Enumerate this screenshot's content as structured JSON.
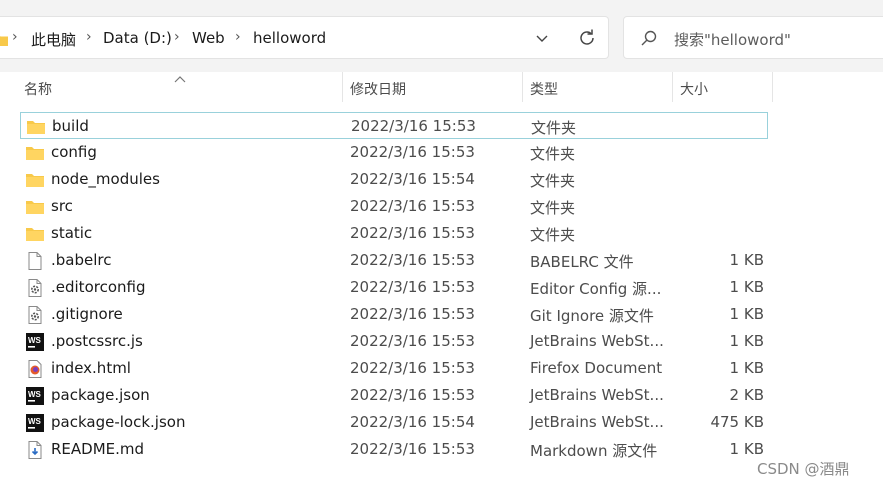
{
  "breadcrumb": [
    "此电脑",
    "Data (D:)",
    "Web",
    "helloword"
  ],
  "search": {
    "placeholder": "搜索\"helloword\""
  },
  "columns": {
    "name": "名称",
    "modified": "修改日期",
    "type": "类型",
    "size": "大小"
  },
  "files": [
    {
      "name": "build",
      "modified": "2022/3/16 15:53",
      "type": "文件夹",
      "size": "",
      "icon": "folder-icon",
      "selected": true
    },
    {
      "name": "config",
      "modified": "2022/3/16 15:53",
      "type": "文件夹",
      "size": "",
      "icon": "folder-icon"
    },
    {
      "name": "node_modules",
      "modified": "2022/3/16 15:54",
      "type": "文件夹",
      "size": "",
      "icon": "folder-icon"
    },
    {
      "name": "src",
      "modified": "2022/3/16 15:53",
      "type": "文件夹",
      "size": "",
      "icon": "folder-icon"
    },
    {
      "name": "static",
      "modified": "2022/3/16 15:53",
      "type": "文件夹",
      "size": "",
      "icon": "folder-icon"
    },
    {
      "name": ".babelrc",
      "modified": "2022/3/16 15:53",
      "type": "BABELRC 文件",
      "size": "1 KB",
      "icon": "file-icon"
    },
    {
      "name": ".editorconfig",
      "modified": "2022/3/16 15:53",
      "type": "Editor Config 源...",
      "size": "1 KB",
      "icon": "config-file-icon"
    },
    {
      "name": ".gitignore",
      "modified": "2022/3/16 15:53",
      "type": "Git Ignore 源文件",
      "size": "1 KB",
      "icon": "config-file-icon"
    },
    {
      "name": ".postcssrc.js",
      "modified": "2022/3/16 15:53",
      "type": "JetBrains WebSt...",
      "size": "1 KB",
      "icon": "webstorm-icon"
    },
    {
      "name": "index.html",
      "modified": "2022/3/16 15:53",
      "type": "Firefox Document",
      "size": "1 KB",
      "icon": "firefox-document-icon"
    },
    {
      "name": "package.json",
      "modified": "2022/3/16 15:53",
      "type": "JetBrains WebSt...",
      "size": "2 KB",
      "icon": "webstorm-icon"
    },
    {
      "name": "package-lock.json",
      "modified": "2022/3/16 15:54",
      "type": "JetBrains WebSt...",
      "size": "475 KB",
      "icon": "webstorm-icon"
    },
    {
      "name": "README.md",
      "modified": "2022/3/16 15:53",
      "type": "Markdown 源文件",
      "size": "1 KB",
      "icon": "markdown-file-icon"
    }
  ],
  "watermark": "CSDN @酒鼎",
  "colors": {
    "folder": "#f8c94a",
    "selection_border": "#99d1db",
    "header_text": "#4c4c4c"
  }
}
